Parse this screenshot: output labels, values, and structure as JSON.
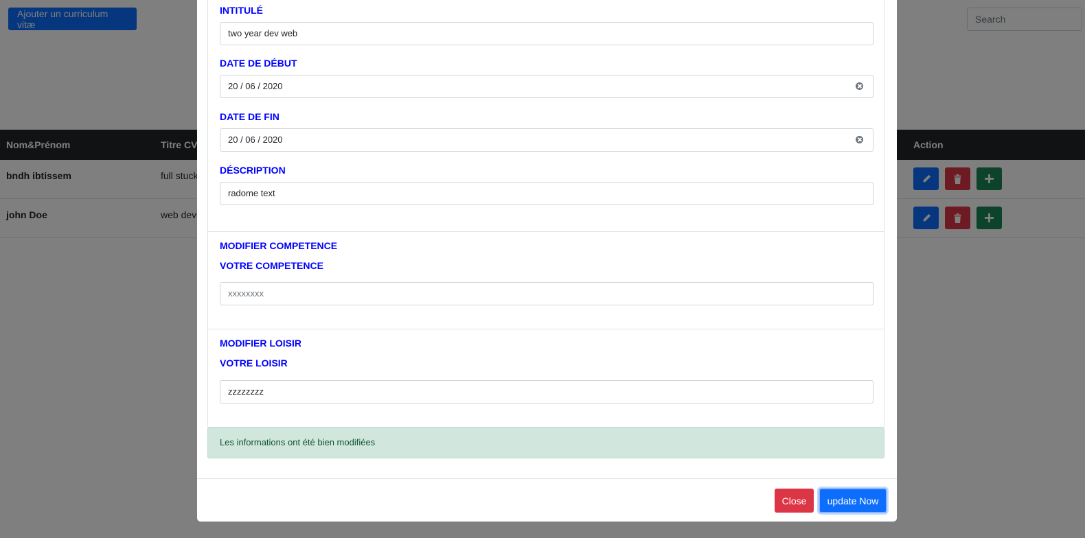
{
  "toolbar": {
    "add_label": "Ajouter un curriculum vitæ",
    "search_placeholder": "Search"
  },
  "table": {
    "headers": {
      "name": "Nom&Prénom",
      "title": "Titre CV",
      "action": "Action"
    },
    "rows": [
      {
        "name": "bndh ibtissem",
        "title": "full stuck"
      },
      {
        "name": "john Doe",
        "title": "web deve"
      }
    ]
  },
  "icons": {
    "edit": "pencil-icon",
    "delete": "trash-icon",
    "add": "plus-icon",
    "clear": "clear-icon"
  },
  "colors": {
    "label": "#0000ff",
    "primary": "#0d6efd",
    "danger": "#dc3545",
    "success": "#198754",
    "alert_bg": "#d1e7dd"
  },
  "modal": {
    "experience": {
      "intitule_label": "Intitulé",
      "intitule_value": "two year dev web",
      "date_debut_label": "Date de début",
      "date_debut_value": "20 / 06 / 2020",
      "date_fin_label": "Date de fin",
      "date_fin_value": "20 / 06 / 2020",
      "description_label": "Déscription",
      "description_value": "radome text"
    },
    "competence": {
      "section_title": "Modifier competence",
      "label": "Votre competence",
      "placeholder": "xxxxxxxx"
    },
    "loisir": {
      "section_title": "Modifier loisir",
      "label": "Votre loisir",
      "value": "zzzzzzzz"
    },
    "alert": "Les informations ont été bien modifiées",
    "close_label": "Close",
    "update_label": "update Now"
  }
}
